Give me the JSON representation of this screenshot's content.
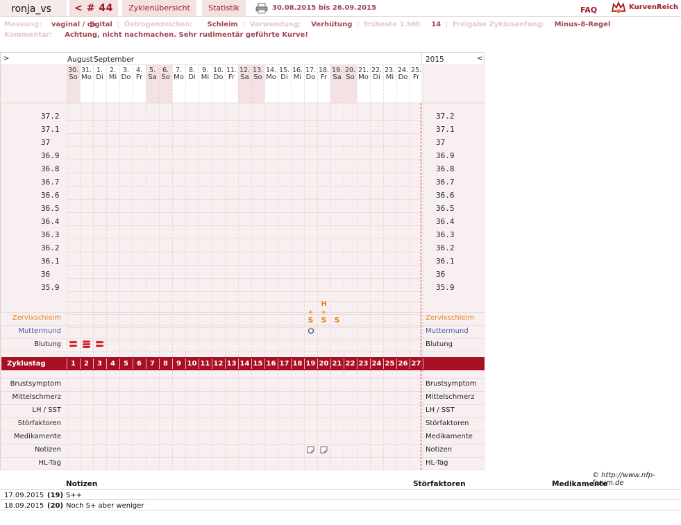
{
  "header": {
    "user": "ronja_vs",
    "cycle": "< # 44 >",
    "nav_overview": "Zyklenübersicht",
    "nav_stats": "Statistik",
    "date_range": "30.08.2015 bis 26.09.2015",
    "faq": "FAQ",
    "logo": "KurvenReich"
  },
  "info": {
    "messung_label": "Messung:",
    "messung_value": "vaginal / digital",
    "oestrogen_label": "Östrogenzeichen:",
    "oestrogen_value": "Schleim",
    "verwendung_label": "Verwendung:",
    "verwendung_value": "Verhütung",
    "fruehe_label": "früheste 1.hM:",
    "fruehe_value": "14",
    "freigabe_label": "Freigabe Zyklusanfang:",
    "freigabe_value": "Minus-8-Regel",
    "kommentar_label": "Kommentar:",
    "kommentar_value": "Achtung, nicht nachmachen. Sehr rudimentär geführte Kurve!"
  },
  "chart": {
    "nav_left": ">",
    "nav_right": "<",
    "month1": "August",
    "month2": "September",
    "year": "2015",
    "days": [
      {
        "d": "30.",
        "w": "So",
        "weekend": true
      },
      {
        "d": "31.",
        "w": "Mo",
        "weekend": false
      },
      {
        "d": "1.",
        "w": "Di",
        "weekend": false
      },
      {
        "d": "2.",
        "w": "Mi",
        "weekend": false
      },
      {
        "d": "3.",
        "w": "Do",
        "weekend": false
      },
      {
        "d": "4.",
        "w": "Fr",
        "weekend": false
      },
      {
        "d": "5.",
        "w": "Sa",
        "weekend": true
      },
      {
        "d": "6.",
        "w": "So",
        "weekend": true
      },
      {
        "d": "7.",
        "w": "Mo",
        "weekend": false
      },
      {
        "d": "8.",
        "w": "Di",
        "weekend": false
      },
      {
        "d": "9.",
        "w": "Mi",
        "weekend": false
      },
      {
        "d": "10.",
        "w": "Do",
        "weekend": false
      },
      {
        "d": "11.",
        "w": "Fr",
        "weekend": false
      },
      {
        "d": "12.",
        "w": "Sa",
        "weekend": true
      },
      {
        "d": "13.",
        "w": "So",
        "weekend": true
      },
      {
        "d": "14.",
        "w": "Mo",
        "weekend": false
      },
      {
        "d": "15.",
        "w": "Di",
        "weekend": false
      },
      {
        "d": "16.",
        "w": "Mi",
        "weekend": false
      },
      {
        "d": "17.",
        "w": "Do",
        "weekend": false
      },
      {
        "d": "18.",
        "w": "Fr",
        "weekend": false
      },
      {
        "d": "19.",
        "w": "Sa",
        "weekend": true
      },
      {
        "d": "20.",
        "w": "So",
        "weekend": true
      },
      {
        "d": "21.",
        "w": "Mo",
        "weekend": false
      },
      {
        "d": "22.",
        "w": "Di",
        "weekend": false
      },
      {
        "d": "23.",
        "w": "Mi",
        "weekend": false
      },
      {
        "d": "24.",
        "w": "Do",
        "weekend": false
      },
      {
        "d": "25.",
        "w": "Fr",
        "weekend": false
      }
    ],
    "temps": [
      "37.2",
      "37.1",
      "37",
      "36.9",
      "36.8",
      "36.7",
      "36.6",
      "36.5",
      "36.4",
      "36.3",
      "36.2",
      "36.1",
      "36",
      "35.9"
    ],
    "labels_left": {
      "zervix": "Zervixschleim",
      "muttermund": "Muttermund",
      "blutung": "Blutung",
      "zyklustag": "Zyklustag",
      "brust": "Brustsymptom",
      "mittel": "Mittelschmerz",
      "lh": "LH / SST",
      "stoer": "Störfaktoren",
      "medi": "Medikamente",
      "notizen": "Notizen",
      "hl": "HL-Tag"
    },
    "cycle_days": [
      "1",
      "2",
      "3",
      "4",
      "5",
      "6",
      "7",
      "8",
      "9",
      "10",
      "11",
      "12",
      "13",
      "14",
      "15",
      "16",
      "17",
      "18",
      "19",
      "20",
      "21",
      "22",
      "23",
      "24",
      "25",
      "26",
      "27"
    ],
    "zervix_marks": [
      {
        "day": 19,
        "text": "S",
        "plus": "+"
      },
      {
        "day": 20,
        "text": "S",
        "plus": "+",
        "top": "H"
      },
      {
        "day": 21,
        "text": "S"
      }
    ],
    "blutung_days": [
      1,
      2,
      3
    ],
    "muttermund_days": [
      19
    ],
    "notiz_days": [
      19,
      20
    ]
  },
  "footer": {
    "copyright": "© http://www.nfp-forum.de",
    "col_notizen": "Notizen",
    "col_stoer": "Störfaktoren",
    "col_medi": "Medikamente",
    "rows": [
      {
        "date": "17.09.2015",
        "day": "(19)",
        "note": "S++"
      },
      {
        "date": "18.09.2015",
        "day": "(20)",
        "note": "Noch S+ aber weniger"
      }
    ]
  },
  "colors": {
    "brand": "#a80f24",
    "zervix": "#e58415",
    "muttermund": "#4a56b0",
    "blutung": "#d32031"
  }
}
